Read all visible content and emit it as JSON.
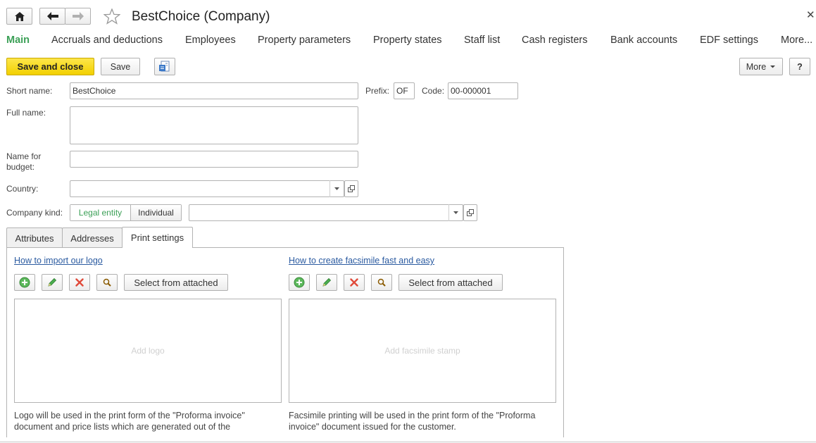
{
  "window": {
    "title": "BestChoice (Company)"
  },
  "nav_tabs": [
    {
      "label": "Main",
      "active": true
    },
    {
      "label": "Accruals and deductions"
    },
    {
      "label": "Employees"
    },
    {
      "label": "Property parameters"
    },
    {
      "label": "Property states"
    },
    {
      "label": "Staff list"
    },
    {
      "label": "Cash registers"
    },
    {
      "label": "Bank accounts"
    },
    {
      "label": "EDF settings"
    },
    {
      "label": "More..."
    }
  ],
  "toolbar": {
    "save_close_label": "Save and close",
    "save_label": "Save",
    "more_label": "More",
    "help_label": "?"
  },
  "form": {
    "short_name_label": "Short name:",
    "short_name_value": "BestChoice",
    "prefix_label": "Prefix:",
    "prefix_value": "OF",
    "code_label": "Code:",
    "code_value": "00-000001",
    "full_name_label": "Full name:",
    "full_name_value": "",
    "budget_name_label_1": "Name for",
    "budget_name_label_2": "budget:",
    "budget_name_value": "",
    "country_label": "Country:",
    "country_value": "",
    "company_kind_label": "Company kind:",
    "kind_options": [
      "Legal entity",
      "Individual"
    ],
    "kind_selected": "Legal entity",
    "kind_detail_value": ""
  },
  "inner_tabs": [
    {
      "label": "Attributes"
    },
    {
      "label": "Addresses"
    },
    {
      "label": "Print settings",
      "active": true
    }
  ],
  "print_settings": {
    "logo": {
      "link": "How to import our logo",
      "select_attached": "Select from attached",
      "placeholder": "Add logo",
      "note_line_1": "Logo will be used in the print form of the \"Proforma invoice\"",
      "note_line_2": "document and price lists which are generated out of the"
    },
    "facsimile": {
      "link": "How to create facsimile fast and easy",
      "select_attached": "Select from attached",
      "placeholder": "Add facsimile stamp",
      "note_line_1": "Facsimile printing will be used in the print form of the \"Proforma",
      "note_line_2": "invoice\" document issued for the customer."
    }
  },
  "colors": {
    "accent_green": "#3ca057",
    "primary_button": "#f5d713",
    "link_blue": "#2a5aa0",
    "delete_red": "#e04a3a"
  }
}
